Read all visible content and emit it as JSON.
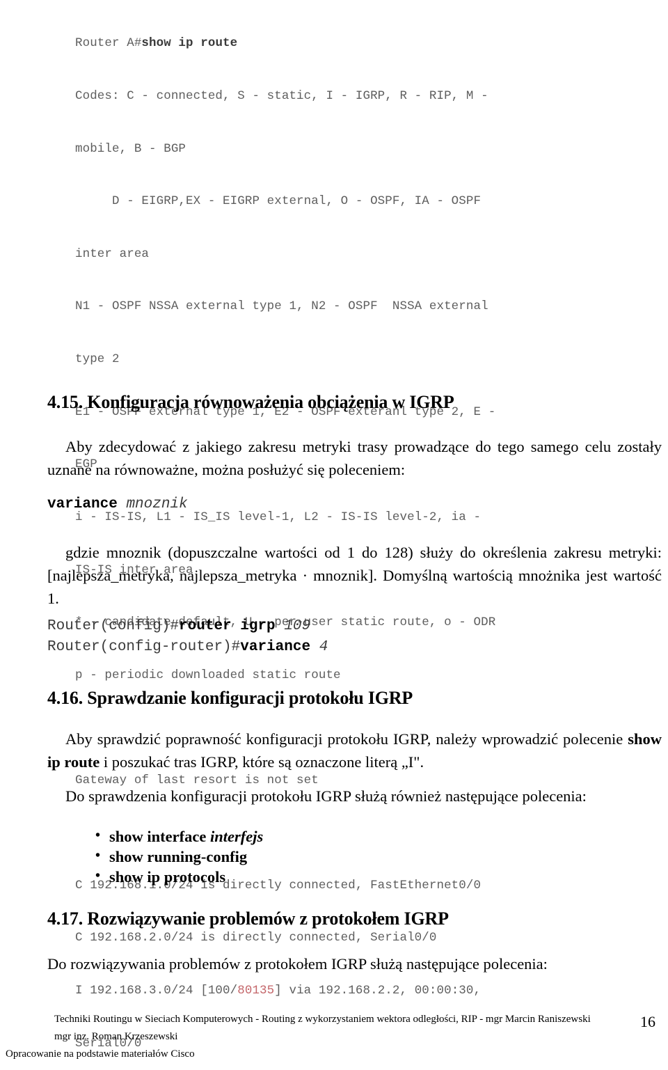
{
  "terminal": {
    "prompt_prefix": "Router A#",
    "prompt_command": "show ip route",
    "lines": [
      "Codes: C - connected, S - static, I - IGRP, R - RIP, M -",
      "mobile, B - BGP",
      "     D - EIGRP,EX - EIGRP external, O - OSPF, IA - OSPF",
      "inter area",
      "N1 - OSPF NSSA external type 1, N2 - OSPF  NSSA external",
      "type 2",
      "E1 - OSPF external type 1, E2 - OSPF exteranl type 2, E -",
      "EGP",
      "i - IS-IS, L1 - IS_IS level-1, L2 - IS-IS level-2, ia -",
      "IS-IS inter area",
      "* - candidate default, U - per-user static route, o - ODR",
      "p - periodic downloaded static route"
    ],
    "gateway_line": "Gateway of last resort is not set",
    "route_1": "C 192.168.1.0/24 is directly connected, FastEthernet0/0",
    "route_2": "C 192.168.2.0/24 is directly connected, Serial0/0",
    "route_3_pre": "I 192.168.3.0/24 [100/",
    "route_3_metric": "80135",
    "route_3_post": "] via 192.168.2.2, 00:00:30,",
    "route_3_cont": "Serial0/0",
    "metric_color": "#c4666a",
    "text_color": "#5e5e5e"
  },
  "section_415": {
    "heading": "4.15. Konfiguracja równoważenia obciążenia w IGRP",
    "intro": "Aby zdecydować z jakiego zakresu metryki trasy prowadzące do tego samego celu zostały uznane na równoważne, można posłużyć się poleceniem:",
    "syntax_command": "variance",
    "syntax_arg": "mnoznik",
    "explanation": "gdzie mnoznik (dopuszczalne wartości od 1 do 128) służy do określenia zakresu metryki: [najlepsza_metryka, najlepsza_metryka · mnoznik]. Domyślną wartością mnożnika jest wartość 1.",
    "config_line_1_prompt": "Router(config)#",
    "config_line_1_cmd": "router igrp",
    "config_line_1_arg": "109",
    "config_line_2_prompt": "Router(config-router)#",
    "config_line_2_cmd": "variance",
    "config_line_2_arg": "4"
  },
  "section_416": {
    "heading": "4.16. Sprawdzanie konfiguracji protokołu IGRP",
    "para_1_a": "Aby sprawdzić poprawność konfiguracji protokołu IGRP, należy wprowadzić polecenie ",
    "para_1_cmd": "show ip route",
    "para_1_b": " i poszukać tras IGRP, które są oznaczone literą „I\".",
    "para_2": "Do sprawdzenia konfiguracji protokołu IGRP służą również następujące polecenia:",
    "bullet_char": "•",
    "commands": [
      {
        "name": "show interface",
        "arg": " interfejs"
      },
      {
        "name": "show running-config",
        "arg": ""
      },
      {
        "name": "show ip protocols",
        "arg": ""
      }
    ]
  },
  "section_417": {
    "heading": "4.17. Rozwiązywanie problemów z protokołem IGRP",
    "para_1": "Do rozwiązywania problemów z protokołem IGRP służą następujące polecenia:"
  },
  "footer": {
    "line_1": "Techniki Routingu w Sieciach Komputerowych - Routing z wykorzystaniem wektora odległości, RIP - mgr Marcin Raniszewski",
    "line_2": "mgr inz. Roman Krzeszewski",
    "line_3": "Opracowanie na podstawie materiałów Cisco",
    "page_number": "16"
  }
}
